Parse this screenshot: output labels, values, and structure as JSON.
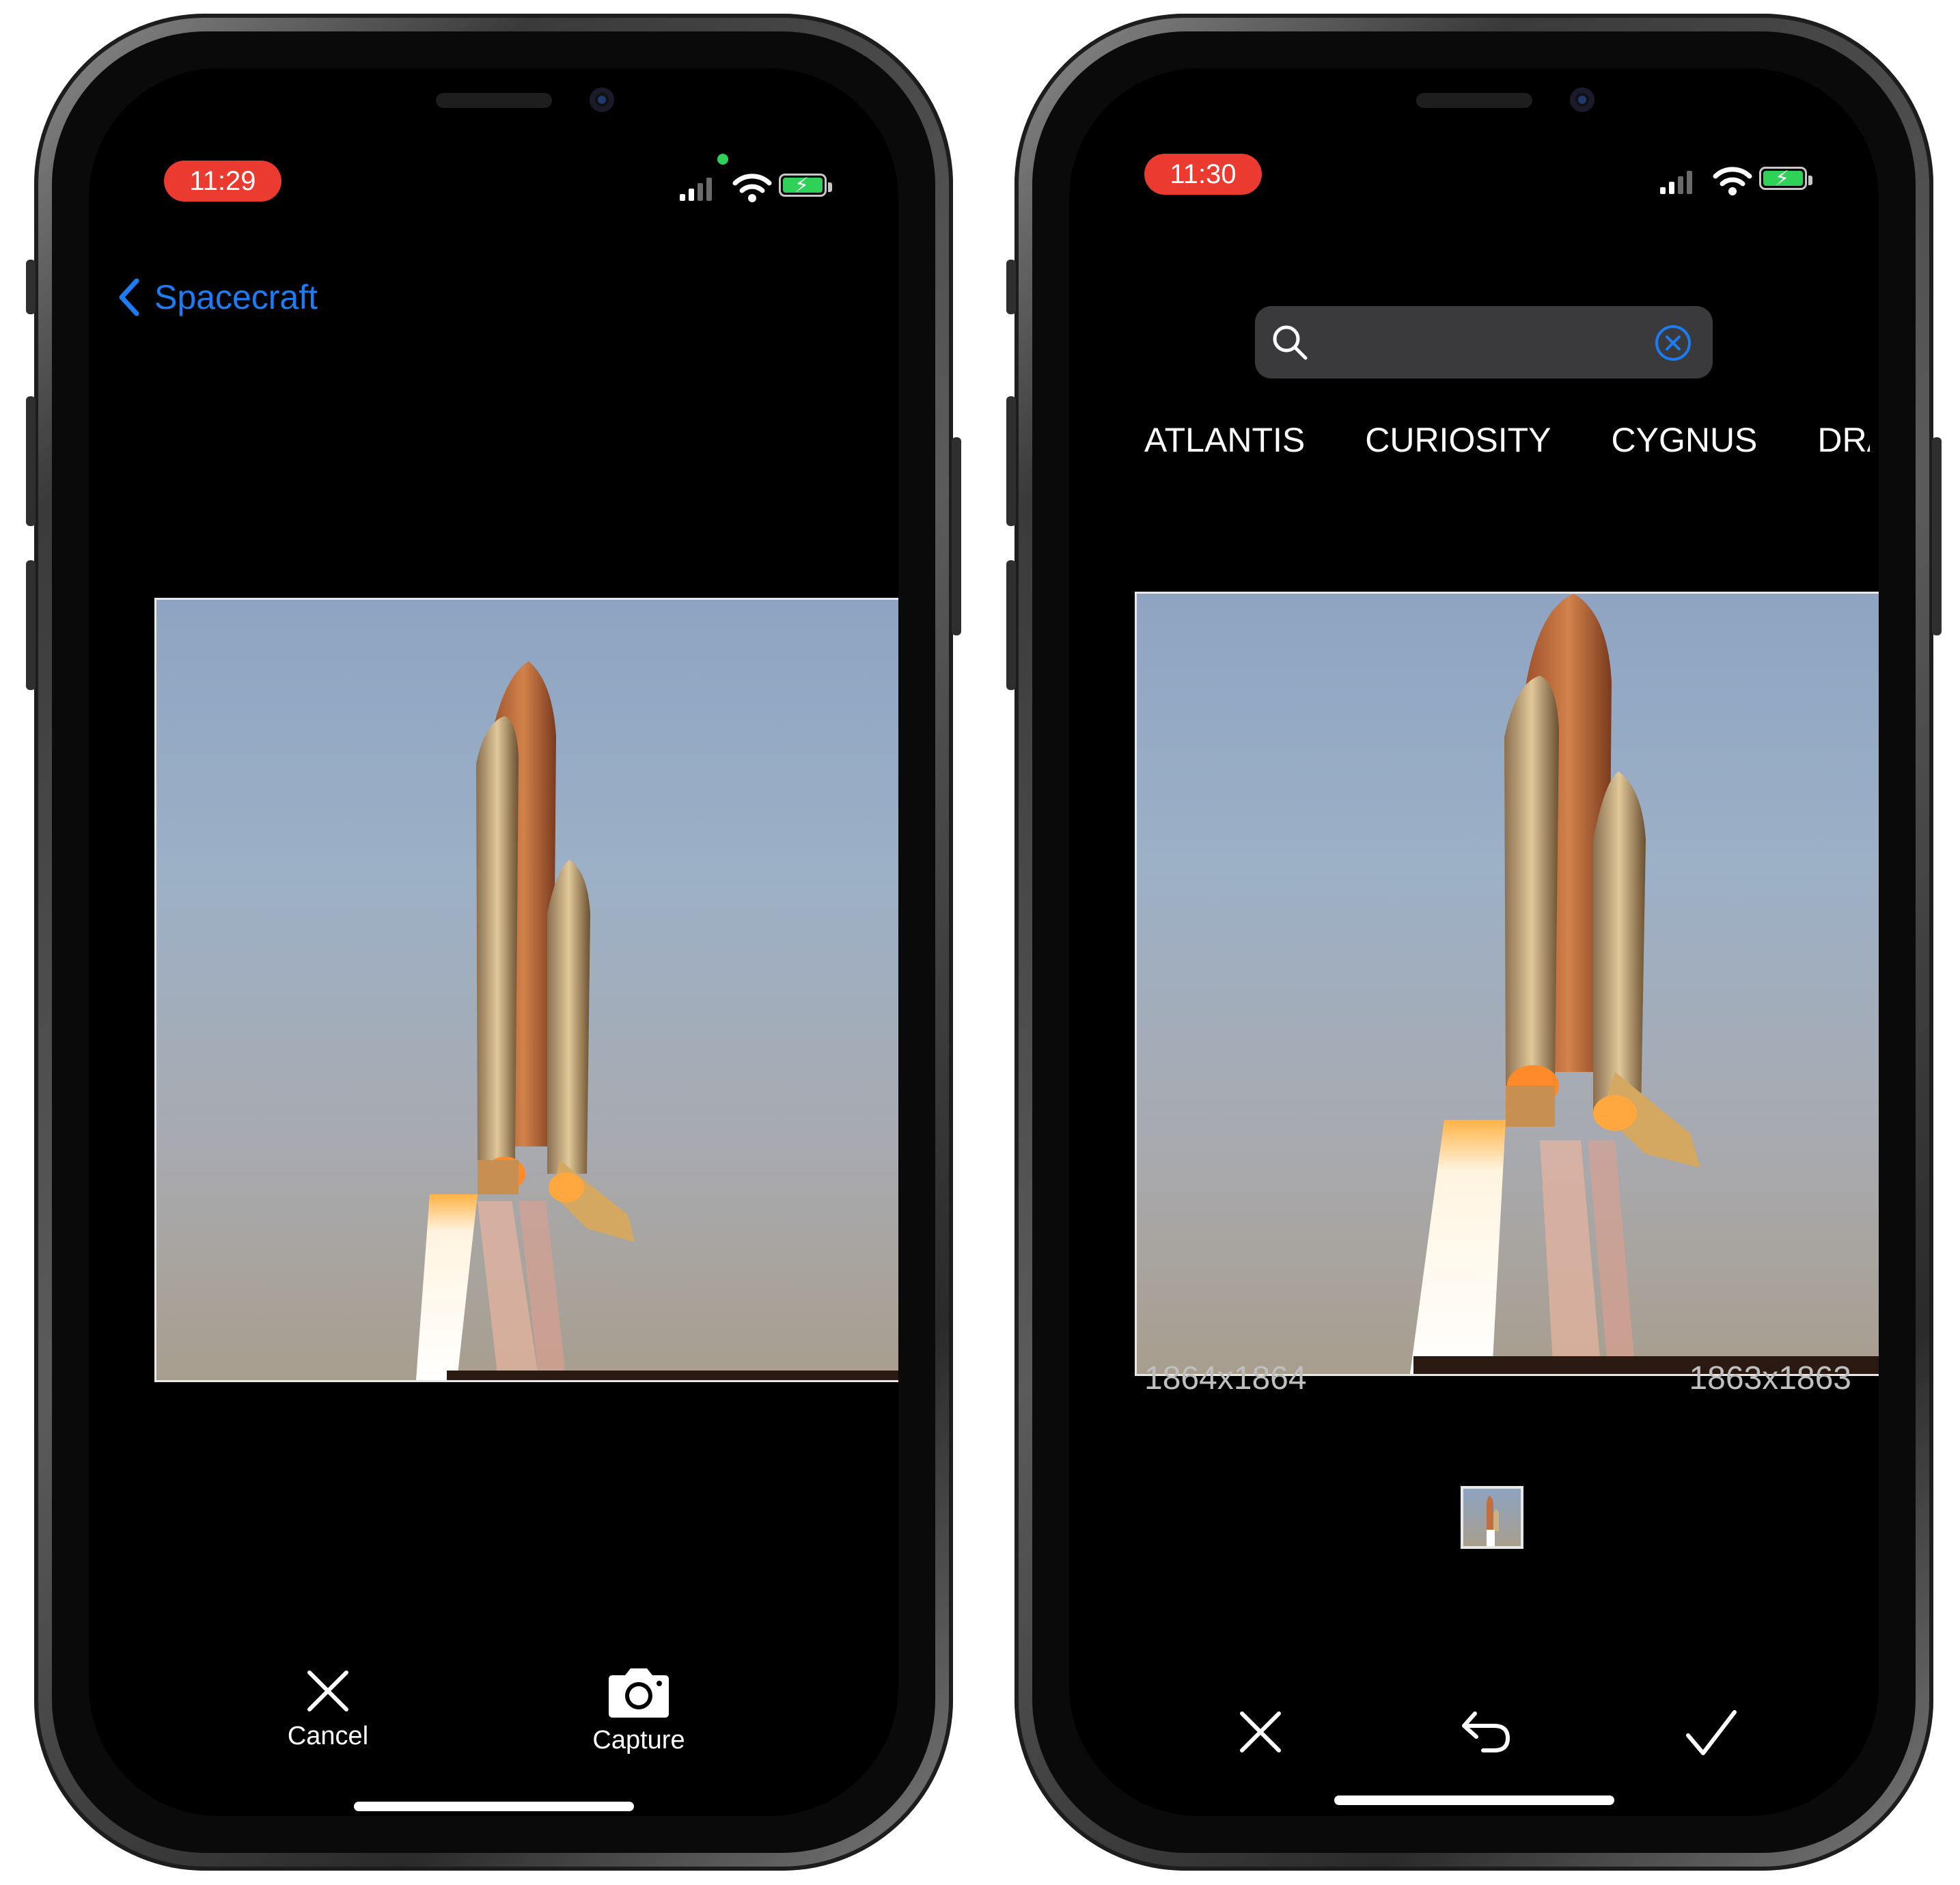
{
  "left_screen": {
    "status": {
      "time": "11:29"
    },
    "nav": {
      "back_label": "Spacecraft"
    },
    "toolbar": {
      "cancel_label": "Cancel",
      "capture_label": "Capture"
    }
  },
  "right_screen": {
    "status": {
      "time": "11:30"
    },
    "search": {
      "value": "",
      "placeholder": ""
    },
    "tags": [
      "ATLANTIS",
      "CURIOSITY",
      "CYGNUS",
      "DRA"
    ],
    "dims_left": "1864x1864",
    "dims_right": "1863x1863"
  },
  "icons": {
    "back": "chevron-left-icon",
    "cancel": "close-icon",
    "capture": "camera-icon",
    "search": "search-icon",
    "clear": "clear-circle-icon",
    "undo": "undo-icon",
    "confirm": "checkmark-icon"
  },
  "colors": {
    "accent": "#1e7cf2",
    "time_pill": "#eb3b30",
    "screen_bg": "#000000",
    "battery": "#2fd158"
  }
}
